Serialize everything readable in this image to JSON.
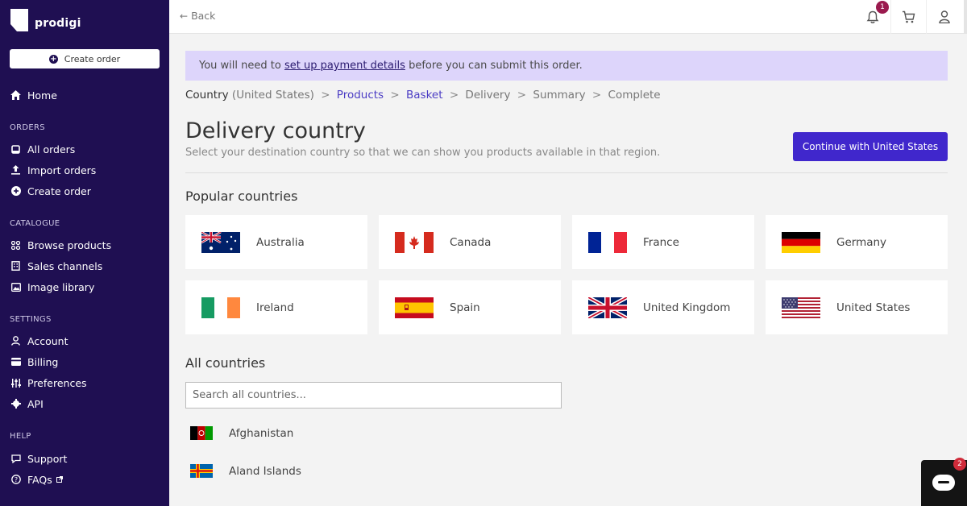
{
  "sidebar": {
    "logo_text": "prodigi",
    "create_button": "Create order",
    "home": "Home",
    "sections": {
      "orders": "ORDERS",
      "catalogue": "CATALOGUE",
      "settings": "SETTINGS",
      "help": "HELP"
    },
    "items": {
      "all_orders": "All orders",
      "import_orders": "Import orders",
      "create_order": "Create order",
      "browse_products": "Browse products",
      "sales_channels": "Sales channels",
      "image_library": "Image library",
      "account": "Account",
      "billing": "Billing",
      "preferences": "Preferences",
      "api": "API",
      "support": "Support",
      "faqs": "FAQs"
    }
  },
  "topbar": {
    "back": "Back",
    "notification_count": "1"
  },
  "alert": {
    "before": "You will need to ",
    "link": "set up payment details",
    "after": " before you can submit this order."
  },
  "breadcrumb": {
    "country": "Country",
    "country_detail": " (United States)",
    "products": "Products",
    "basket": "Basket",
    "delivery": "Delivery",
    "summary": "Summary",
    "complete": "Complete",
    "sep": ">"
  },
  "page": {
    "title": "Delivery country",
    "subtitle": "Select your destination country so that we can show you products available in that region.",
    "continue_button": "Continue with United States",
    "popular_heading": "Popular countries",
    "all_heading": "All countries",
    "search_placeholder": "Search all countries..."
  },
  "popular_countries": [
    "Australia",
    "Canada",
    "France",
    "Germany",
    "Ireland",
    "Spain",
    "United Kingdom",
    "United States"
  ],
  "all_countries": [
    "Afghanistan",
    "Aland Islands"
  ],
  "chat": {
    "badge": "2"
  },
  "colors": {
    "sidebar_bg": "#1f0f52",
    "accent": "#4027cc",
    "alert_bg": "#ddd5fb",
    "badge": "#9a1a4e"
  }
}
